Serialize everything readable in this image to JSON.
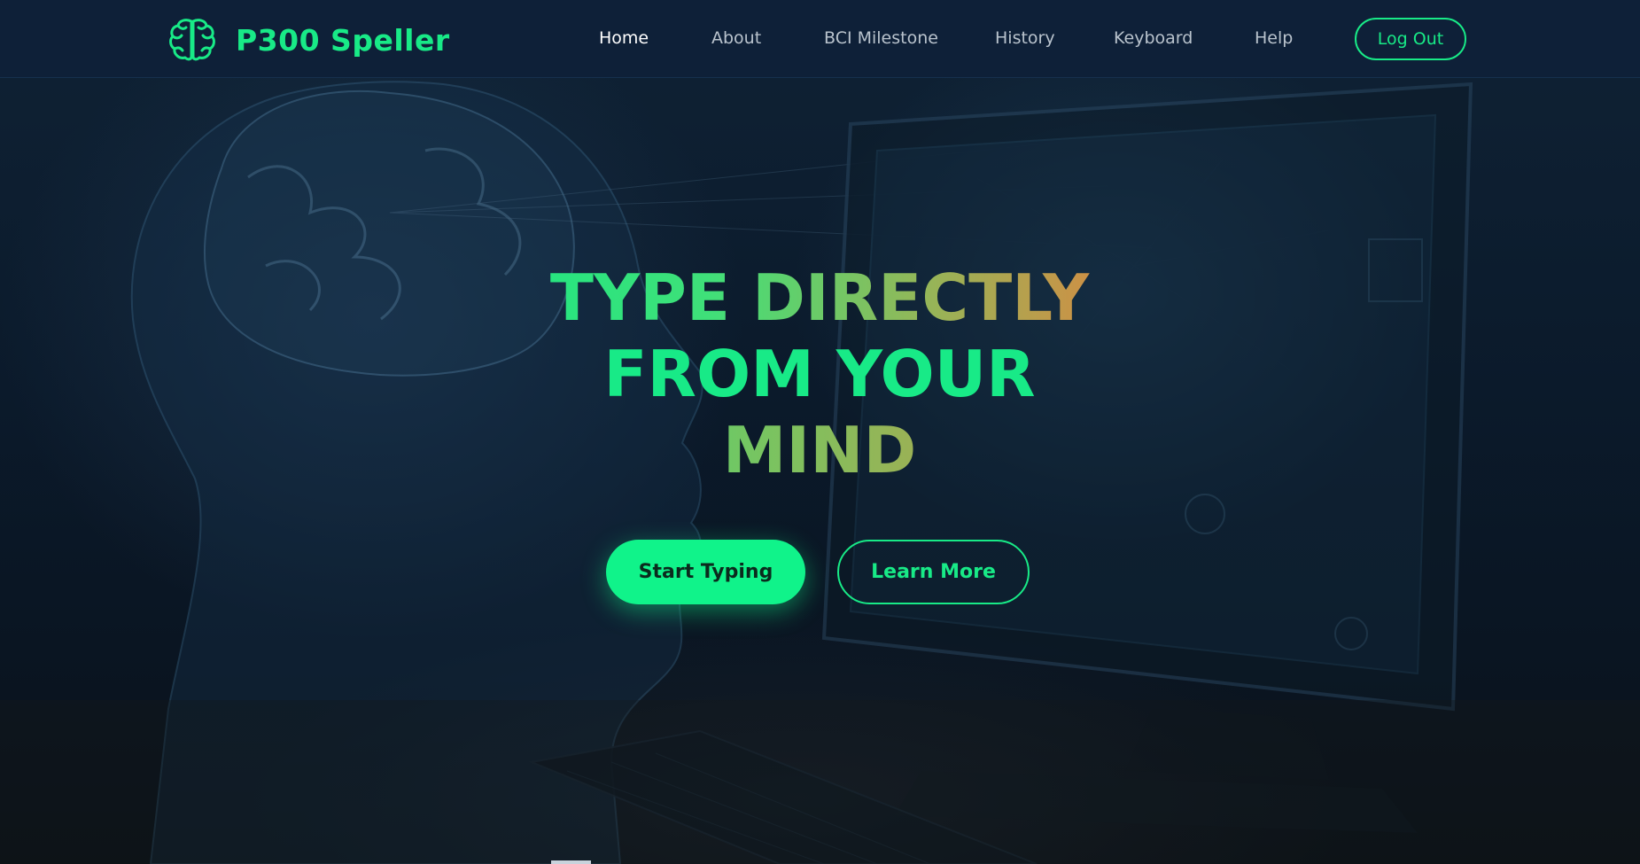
{
  "brand": {
    "name": "P300 Speller",
    "icon": "brain-icon"
  },
  "nav": {
    "items": [
      {
        "label": "Home",
        "active": true
      },
      {
        "label": "About",
        "active": false
      },
      {
        "label": "BCI Milestone",
        "active": false
      },
      {
        "label": "History",
        "active": false
      },
      {
        "label": "Keyboard",
        "active": false
      },
      {
        "label": "Help",
        "active": false
      }
    ],
    "logout_label": "Log Out"
  },
  "hero": {
    "title_lines": [
      "TYPE DIRECTLY",
      "FROM YOUR",
      "MIND"
    ],
    "primary_button": "Start Typing",
    "secondary_button": "Learn More"
  },
  "colors": {
    "accent": "#18ea87",
    "button_fill": "#10f38a",
    "gradient_end": "#f07a3a",
    "navbar_bg": "#0e2038",
    "page_bg": "#0b1a2b"
  }
}
